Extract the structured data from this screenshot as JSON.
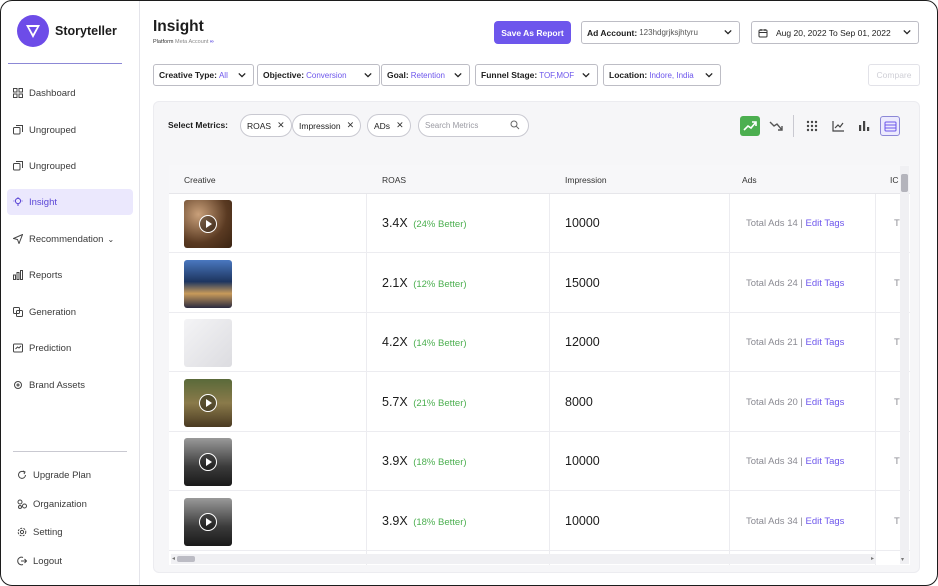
{
  "app": {
    "name": "Storyteller"
  },
  "sidebar": {
    "items": [
      {
        "label": "Dashboard",
        "icon": "grid-icon"
      },
      {
        "label": "Ungrouped",
        "icon": "stack-icon"
      },
      {
        "label": "Ungrouped",
        "icon": "stack-icon"
      },
      {
        "label": "Insight",
        "icon": "lightbulb-icon",
        "active": true
      },
      {
        "label": "Recommendation",
        "icon": "send-icon"
      },
      {
        "label": "Reports",
        "icon": "bar-chart-icon"
      },
      {
        "label": "Generation",
        "icon": "copy-icon"
      },
      {
        "label": "Prediction",
        "icon": "prediction-icon"
      },
      {
        "label": "Brand Assets",
        "icon": "target-icon"
      }
    ],
    "bottom": [
      {
        "label": "Upgrade Plan",
        "icon": "refresh-icon"
      },
      {
        "label": "Organization",
        "icon": "org-icon"
      },
      {
        "label": "Setting",
        "icon": "gear-icon"
      },
      {
        "label": "Logout",
        "icon": "logout-icon"
      }
    ]
  },
  "header": {
    "title": "Insight",
    "platform_label": "Platform",
    "platform_value": "Meta Account",
    "save_label": "Save As Report",
    "ad_account_label": "Ad Account:",
    "ad_account_value": "123hdgrjksjhtyru",
    "date_range": "Aug 20, 2022 To Sep 01, 2022"
  },
  "filters": [
    {
      "label": "Creative Type:",
      "value": "All"
    },
    {
      "label": "Objective:",
      "value": "Conversion"
    },
    {
      "label": "Goal:",
      "value": "Retention"
    },
    {
      "label": "Funnel Stage:",
      "value": "TOF,MOF"
    },
    {
      "label": "Location:",
      "value": "Indore, India"
    }
  ],
  "compare_label": "Compare",
  "metrics": {
    "label": "Select Metrics:",
    "chips": [
      "ROAS",
      "Impression",
      "ADs"
    ],
    "search_placeholder": "Search Metrics"
  },
  "table": {
    "columns": [
      "Creative",
      "ROAS",
      "Impression",
      "Ads",
      "IC"
    ],
    "rows": [
      {
        "roas": "3.4X",
        "better": "(24% Better)",
        "impression": "10000",
        "ads": "Total Ads 14 |",
        "edit": "Edit Tags",
        "cut": "T",
        "video": true,
        "thumb": "#7a5a40"
      },
      {
        "roas": "2.1X",
        "better": "(12% Better)",
        "impression": "15000",
        "ads": "Total Ads 24 |",
        "edit": "Edit Tags",
        "cut": "T",
        "video": false,
        "thumb": "#2a4a7a"
      },
      {
        "roas": "4.2X",
        "better": "(14% Better)",
        "impression": "12000",
        "ads": "Total Ads 21 |",
        "edit": "Edit Tags",
        "cut": "T",
        "video": false,
        "thumb": "#e8e8ea"
      },
      {
        "roas": "5.7X",
        "better": "(21% Better)",
        "impression": "8000",
        "ads": "Total Ads 20 |",
        "edit": "Edit Tags",
        "cut": "T",
        "video": true,
        "thumb": "#6a6a40"
      },
      {
        "roas": "3.9X",
        "better": "(18% Better)",
        "impression": "10000",
        "ads": "Total Ads 34 |",
        "edit": "Edit Tags",
        "cut": "T",
        "video": true,
        "thumb": "#4a4a4a"
      },
      {
        "roas": "3.9X",
        "better": "(18% Better)",
        "impression": "10000",
        "ads": "Total Ads 34 |",
        "edit": "Edit Tags",
        "cut": "T",
        "video": true,
        "thumb": "#4a4a4a"
      }
    ]
  },
  "colors": {
    "accent": "#6d56ec",
    "positive": "#4caf50"
  }
}
